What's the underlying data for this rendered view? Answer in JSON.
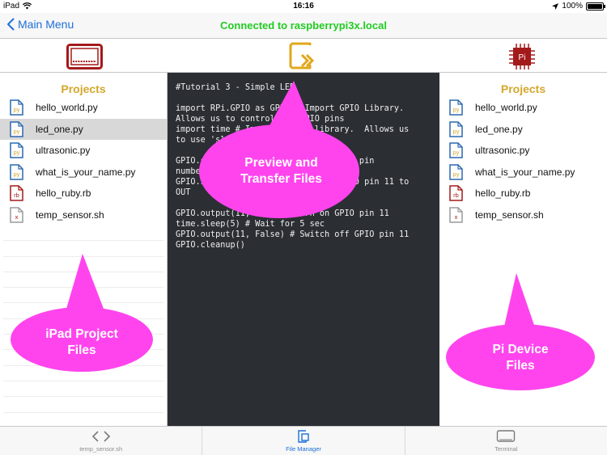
{
  "status_bar": {
    "carrier": "iPad",
    "time": "16:16",
    "battery": "100%",
    "battery_level": 1.0
  },
  "nav": {
    "back_label": "Main Menu",
    "title": "Connected to raspberrypi3x.local"
  },
  "left_panel": {
    "header": "Projects",
    "files": [
      {
        "name": "hello_world.py",
        "type": "py"
      },
      {
        "name": "led_one.py",
        "type": "py",
        "selected": true
      },
      {
        "name": "ultrasonic.py",
        "type": "py"
      },
      {
        "name": "what_is_your_name.py",
        "type": "py"
      },
      {
        "name": "hello_ruby.rb",
        "type": "rb"
      },
      {
        "name": "temp_sensor.sh",
        "type": "x"
      }
    ]
  },
  "right_panel": {
    "header": "Projects",
    "files": [
      {
        "name": "hello_world.py",
        "type": "py"
      },
      {
        "name": "led_one.py",
        "type": "py"
      },
      {
        "name": "ultrasonic.py",
        "type": "py"
      },
      {
        "name": "what_is_your_name.py",
        "type": "py"
      },
      {
        "name": "hello_ruby.rb",
        "type": "rb"
      },
      {
        "name": "temp_sensor.sh",
        "type": "x"
      }
    ]
  },
  "editor": {
    "code": "#Tutorial 3 - Simple LED\n\nimport RPi.GPIO as GPIO # Import GPIO Library.\nAllows us to control the GPIO pins\nimport time # Import 'time' library.  Allows us\nto use 'sleep'\n\nGPIO.setmode(GPIO.BOARD) # Use BOARD pin\nnumbering\nGPIO.setup(11, GPIO.OUT) # Setup GPIO pin 11 to\nOUT\n\nGPIO.output(11, True) # Turn on GPIO pin 11\ntime.sleep(5) # Wait for 5 sec\nGPIO.output(11, False) # Switch off GPIO pin 11\nGPIO.cleanup()"
  },
  "callouts": {
    "preview": "Preview and\nTransfer Files",
    "ipad": "iPad Project\nFiles",
    "pi": "Pi Device\nFiles"
  },
  "toolbar_icons": {
    "left": "ipad-device-icon",
    "center": "transfer-file-icon",
    "right": "pi-chip-icon",
    "chip_label": "Pi"
  },
  "tabs": [
    {
      "label": "temp_sensor.sh",
      "icon": "code-brackets-icon"
    },
    {
      "label": "File Manager",
      "icon": "file-manager-icon",
      "active": true
    },
    {
      "label": "Terminal",
      "icon": "terminal-icon"
    }
  ],
  "colors": {
    "accent_blue": "#1e6fd9",
    "connected_green": "#22cc22",
    "project_gold": "#d4a72c",
    "callout_magenta": "#ff44ee",
    "editor_bg": "#2b2e33",
    "ipad_red": "#a31a1a",
    "transfer_gold": "#e0a81c"
  }
}
